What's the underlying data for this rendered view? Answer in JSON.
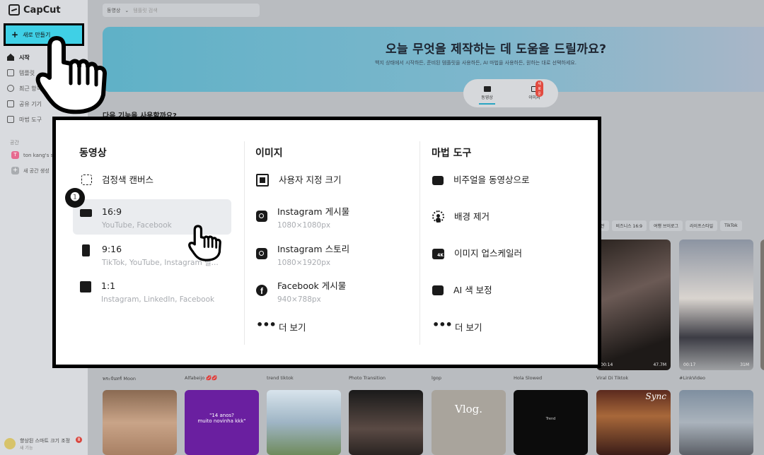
{
  "app": {
    "logo": "CapCut"
  },
  "sidebar": {
    "create_button": "새로 만들기",
    "nav": [
      {
        "label": "시작",
        "active": true
      },
      {
        "label": "템플릿"
      },
      {
        "label": "최근 항목"
      },
      {
        "label": "공유 기기"
      },
      {
        "label": "마법 도구"
      }
    ],
    "space_label": "공간",
    "spaces": [
      {
        "initial": "T",
        "label": "ton kang's space"
      },
      {
        "initial": "+",
        "label": "새 공간 생성"
      }
    ],
    "upgrade": {
      "title": "향상된 스마트 크기 조정",
      "sub": "새 기능",
      "badge": "8"
    }
  },
  "topbar": {
    "dropdown": "동영상",
    "search_placeholder": "템플릿 검색"
  },
  "hero": {
    "title": "오늘 무엇을 제작하는 데 도움을 드릴까요?",
    "subtitle": "백지 상태에서 시작하든, 준비된 템플릿을 사용하든, AI 마법을 사용하든, 원하는 대로 선택하세요.",
    "tabs": [
      {
        "label": "동영상",
        "active": true
      },
      {
        "label": "이미지",
        "badge": "새로운"
      }
    ]
  },
  "section_question": "다음 기능을 사용할까요?",
  "chips": [
    "전",
    "비즈니스 16:9",
    "여행 브이로그",
    "라이프스타일",
    "TikTok"
  ],
  "thumbnails": [
    {
      "caption": "พระจันทร์ Moon"
    },
    {
      "caption": "Alfabeijo 💋💋"
    },
    {
      "caption": "trend tiktok"
    },
    {
      "caption": "Photo Transition"
    },
    {
      "caption": "lgop"
    },
    {
      "caption": "Hola Slowed"
    },
    {
      "caption": "Viral Di Tiktok",
      "time": "00:14",
      "likes": "47.7M"
    },
    {
      "caption": "#LinkVideo",
      "time": "00:17",
      "likes": "31M"
    }
  ],
  "bottom_thumbs": [
    {
      "text": "\"14 anos?\nmuito novinha kkk\""
    },
    {
      "text": "Vlog."
    },
    {
      "text": "Trend"
    },
    {
      "text": "Sync"
    }
  ],
  "panel": {
    "columns": [
      {
        "title": "동영상",
        "items": [
          {
            "icon": "dashed-canvas-icon",
            "label": "검정색 캔버스"
          },
          {
            "icon": "landscape-ratio-icon",
            "label": "16:9",
            "sub": "YouTube, Facebook",
            "selected": true
          },
          {
            "icon": "portrait-ratio-icon",
            "label": "9:16",
            "sub": "TikTok, YouTube, Instagram 릴..."
          },
          {
            "icon": "square-ratio-icon",
            "label": "1:1",
            "sub": "Instagram, LinkedIn, Facebook"
          }
        ]
      },
      {
        "title": "이미지",
        "items": [
          {
            "icon": "custom-size-icon",
            "label": "사용자 지정 크기"
          },
          {
            "icon": "instagram-icon",
            "label": "Instagram 게시물",
            "sub": "1080×1080px"
          },
          {
            "icon": "instagram-icon",
            "label": "Instagram 스토리",
            "sub": "1080×1920px"
          },
          {
            "icon": "facebook-icon",
            "label": "Facebook 게시물",
            "sub": "940×788px"
          },
          {
            "icon": "more-icon",
            "label": "더 보기"
          }
        ]
      },
      {
        "title": "마법 도구",
        "items": [
          {
            "icon": "visual-to-video-icon",
            "label": "비주얼을 동영상으로"
          },
          {
            "icon": "remove-background-icon",
            "label": "배경 제거"
          },
          {
            "icon": "upscale-4k-icon",
            "label": "이미지 업스케일러"
          },
          {
            "icon": "ai-color-icon",
            "label": "AI 색 보정"
          },
          {
            "icon": "more-icon",
            "label": "더 보기"
          }
        ]
      }
    ]
  },
  "step_number": "❶",
  "colors": {
    "accent": "#3fd0e6",
    "highlight": "#eaecef"
  }
}
